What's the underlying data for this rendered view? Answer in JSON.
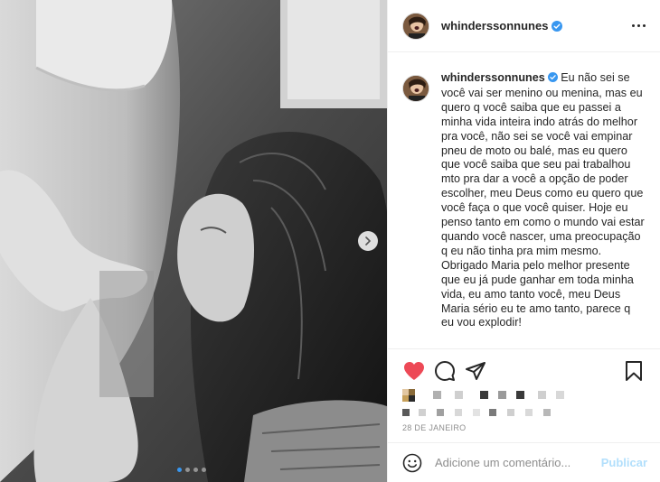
{
  "post": {
    "username": "whinderssonnunes",
    "verified": true,
    "caption_username": "whinderssonnunes",
    "caption_text": " Eu não sei se você vai ser menino ou menina, mas eu quero q você saiba que eu passei a minha vida inteira indo atrás do melhor pra você, não sei se você vai empinar pneu de moto ou balé, mas eu quero que você saiba que seu pai trabalhou mto pra dar a você a opção de poder escolher, meu Deus como eu quero que você faça o que você quiser. Hoje eu penso tanto em como o mundo vai estar quando você nascer, uma preocupação q eu não tinha pra mim mesmo.\nObrigado Maria pelo melhor presente que eu já pude ganhar em toda minha vida, eu amo tanto você, meu Deus Maria sério eu te amo tanto, parece q eu vou explodir!",
    "date": "28 DE JANEIRO",
    "liked": true,
    "carousel_count": 4,
    "carousel_active": 0
  },
  "comment_box": {
    "placeholder": "Adicione um comentário...",
    "publish_label": "Publicar"
  },
  "icons": {
    "like": "heart-filled-icon",
    "comment": "speech-bubble-icon",
    "share": "paper-plane-icon",
    "save": "bookmark-icon",
    "more": "three-dots-icon",
    "emoji": "smiley-icon",
    "next": "chevron-right-icon",
    "verified": "verified-badge-icon"
  },
  "colors": {
    "like_red": "#ed4956",
    "verified_blue": "#3897f0",
    "publish_disabled": "#b2dffc",
    "muted_text": "#8e8e8e"
  }
}
